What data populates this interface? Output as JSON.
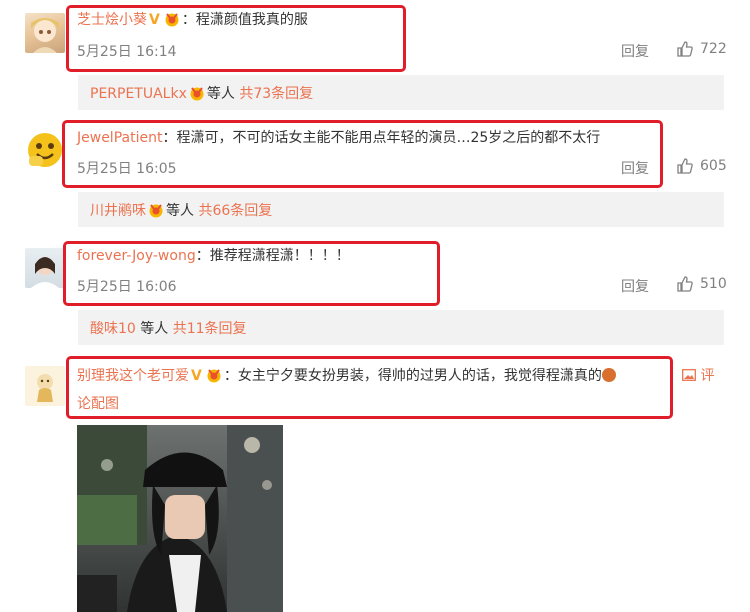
{
  "comments": [
    {
      "username": "芝士烩小葵",
      "text": "：程潇颜值我真的服",
      "date": "5月25日 16:14",
      "reply_label": "回复",
      "likes": "722",
      "thread": {
        "names": "PERPETUALkx",
        "mid": "等人",
        "count_text": "共73条回复"
      }
    },
    {
      "username": "JewelPatient",
      "text": "：程潇可，不可的话女主能不能用点年轻的演员…25岁之后的都不太行",
      "date": "5月25日 16:05",
      "reply_label": "回复",
      "likes": "605",
      "thread": {
        "names": "川井鹇咊",
        "mid": "等人",
        "count_text": "共66条回复"
      }
    },
    {
      "username": "forever-Joy-wong",
      "text": "：推荐程潇程潇！！！！",
      "date": "5月25日 16:06",
      "reply_label": "回复",
      "likes": "510",
      "thread": {
        "names": "酸味10",
        "mid": "等人",
        "count_text": "共11条回复"
      }
    },
    {
      "username": "别理我这个老可爱",
      "text": "：女主宁夕要女扮男装，得帅的过男人的话，我觉得程潇真的",
      "image_link_1": "评",
      "image_link_2": "论配图"
    }
  ],
  "colors": {
    "name": "#eb7350",
    "highlight_box": "#e01e2a",
    "thread_bg": "#f2f2f2"
  }
}
